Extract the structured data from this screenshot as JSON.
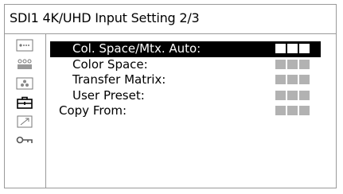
{
  "screen": {
    "title": "SDI1 4K/UHD Input Setting 2/3"
  },
  "sidebar": {
    "icons": [
      {
        "name": "camera-settings-icon"
      },
      {
        "name": "people-icon"
      },
      {
        "name": "color-dots-icon"
      },
      {
        "name": "toolbox-icon",
        "active": true
      },
      {
        "name": "arrow-out-icon"
      },
      {
        "name": "key-icon"
      }
    ]
  },
  "menu": {
    "items": [
      {
        "label": "Col. Space/Mtx. Auto:",
        "indent": true,
        "selected": true,
        "value": "■■■"
      },
      {
        "label": "Color Space:",
        "indent": true,
        "selected": false,
        "value": "■■■"
      },
      {
        "label": "Transfer Matrix:",
        "indent": true,
        "selected": false,
        "value": "■■■"
      },
      {
        "label": "User Preset:",
        "indent": true,
        "selected": false,
        "value": "■■■"
      },
      {
        "label": "Copy From:",
        "indent": false,
        "selected": false,
        "value": "■■■"
      }
    ]
  },
  "colors": {
    "selection_bg": "#000000",
    "selection_text": "#ffffff",
    "value_placeholder": "#b2b2b2",
    "rule": "#9a9a9a"
  }
}
